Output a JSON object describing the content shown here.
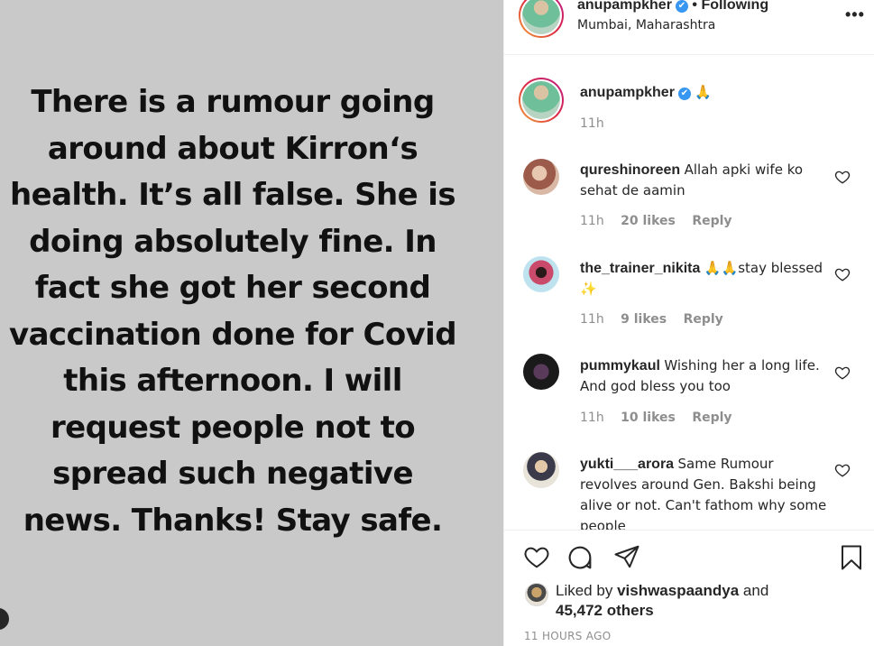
{
  "post": {
    "image_text_lines": [
      "There is a rumour going",
      "around about Kirron‘s",
      "health. It’s all false. She is",
      "doing absolutely fine. In",
      "fact she got her second",
      "vaccination done for Covid",
      "this afternoon. I will",
      "request people not to",
      "spread such negative",
      "news. Thanks! Stay safe."
    ]
  },
  "header": {
    "username": "anupampkher",
    "verified_icon": "✔",
    "separator": "•",
    "following_label": "Following",
    "location": "Mumbai, Maharashtra",
    "more_icon": "•••"
  },
  "caption": {
    "username": "anupampkher",
    "text": "🙏",
    "time": "11h"
  },
  "comments": [
    {
      "username": "qureshinoreen",
      "text": "Allah apki wife ko sehat de aamin",
      "time": "11h",
      "likes": "20 likes",
      "reply": "Reply",
      "avatar_color": "#b58a7a"
    },
    {
      "username": "the_trainer_nikita",
      "text": "🙏🙏stay blessed ✨",
      "time": "11h",
      "likes": "9 likes",
      "reply": "Reply",
      "avatar_color": "#7fb6c9"
    },
    {
      "username": "pummykaul",
      "text": "Wishing her a long life. And god bless you too",
      "time": "11h",
      "likes": "10 likes",
      "reply": "Reply",
      "avatar_color": "#3a2e3a"
    },
    {
      "username": "yukti___arora",
      "text": "Same Rumour revolves around Gen. Bakshi being alive or not. Can't fathom why some people",
      "time": "",
      "likes": "",
      "reply": "",
      "avatar_color": "#c9b89a"
    }
  ],
  "actions": {
    "liked_prefix": "Liked by",
    "liked_user": "vishwaspaandya",
    "liked_and": "and",
    "liked_others": "45,472 others",
    "timestamp": "11 HOURS AGO"
  },
  "colors": {
    "image_bg": "#c9c9c9",
    "verified": "#3897f0",
    "muted": "#8e8e8e"
  }
}
